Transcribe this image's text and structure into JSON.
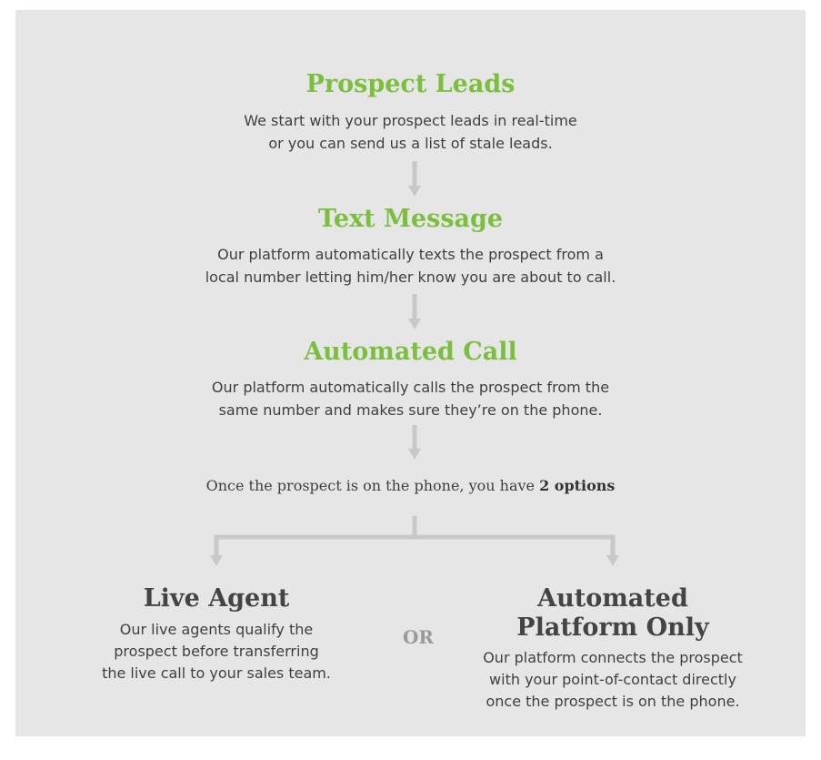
{
  "steps": [
    {
      "title": "Prospect Leads",
      "lines": [
        "We start with your prospect leads in real-time",
        "or you can send us a list of stale leads."
      ]
    },
    {
      "title": "Text Message",
      "lines": [
        "Our platform automatically texts the prospect from a",
        "local number letting him/her know you are about to call."
      ]
    },
    {
      "title": "Automated Call",
      "lines": [
        "Our platform automatically calls the prospect from the",
        "same number and makes sure they’re on the phone."
      ]
    }
  ],
  "options_intro": {
    "text": "Once the prospect is on the phone, you have ",
    "emphasis": "2 options"
  },
  "options": [
    {
      "title_lines": [
        "Live Agent"
      ],
      "lines": [
        "Our live agents qualify the",
        "prospect before transferring",
        "the live call to your sales team."
      ]
    },
    {
      "title_lines": [
        "Automated",
        "Platform Only"
      ],
      "lines": [
        "Our platform connects the prospect",
        "with your point-of-contact directly",
        "once the prospect is on the phone."
      ]
    }
  ],
  "or_label": "OR",
  "colors": {
    "background": "#e6e6e6",
    "step_title": "#7cbf3f",
    "option_title": "#444444",
    "text": "#3f3f3f",
    "connector": "#c8c8c8"
  }
}
